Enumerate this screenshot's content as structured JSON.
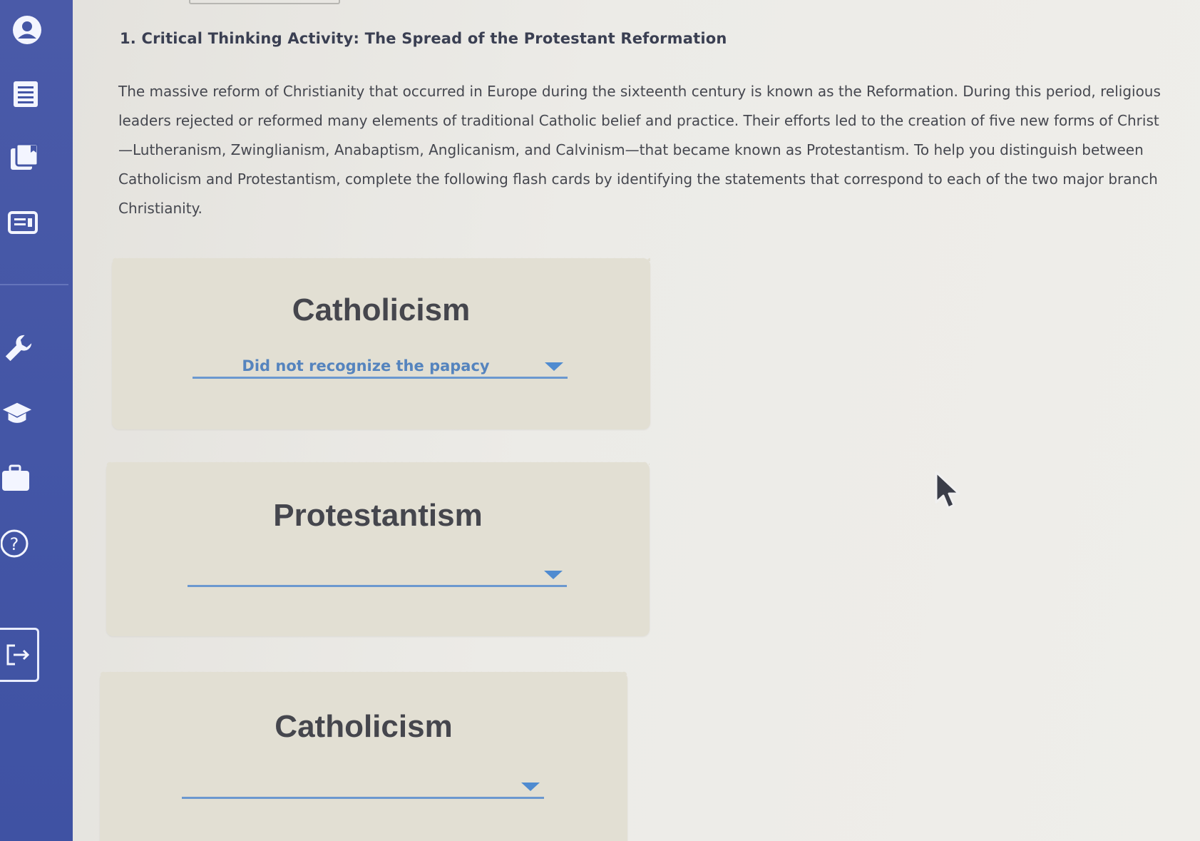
{
  "sidebar": {
    "icons": [
      {
        "name": "user-icon"
      },
      {
        "name": "notebook-icon"
      },
      {
        "name": "flashcards-icon"
      },
      {
        "name": "id-card-icon"
      },
      {
        "name": "wrench-icon"
      },
      {
        "name": "graduation-cap-icon"
      },
      {
        "name": "briefcase-icon"
      },
      {
        "name": "help-icon",
        "glyph": "?"
      },
      {
        "name": "exit-icon"
      }
    ],
    "accent": "#4456a6"
  },
  "question": {
    "title": "1. Critical Thinking Activity: The Spread of the Protestant Reformation",
    "intro_lines": [
      "The massive reform of Christianity that occurred in Europe during the sixteenth century is known as the Reformation. During this period, religious",
      "leaders rejected or reformed many elements of traditional Catholic belief and practice. Their efforts led to the creation of five new forms of Christ",
      "—Lutheranism, Zwinglianism, Anabaptism, Anglicanism, and Calvinism—that became known as Protestantism. To help you distinguish between",
      "Catholicism and Protestantism, complete the following flash cards by identifying the statements that correspond to each of the two major branch",
      "Christianity."
    ]
  },
  "cards": [
    {
      "title": "Catholicism",
      "selected": "Did not recognize the papacy"
    },
    {
      "title": "Protestantism",
      "selected": ""
    },
    {
      "title": "Catholicism",
      "selected": ""
    }
  ],
  "colors": {
    "dropdown_text": "#5584be",
    "dropdown_line": "#6b98cf",
    "card_bg": "#e2dfd3"
  }
}
